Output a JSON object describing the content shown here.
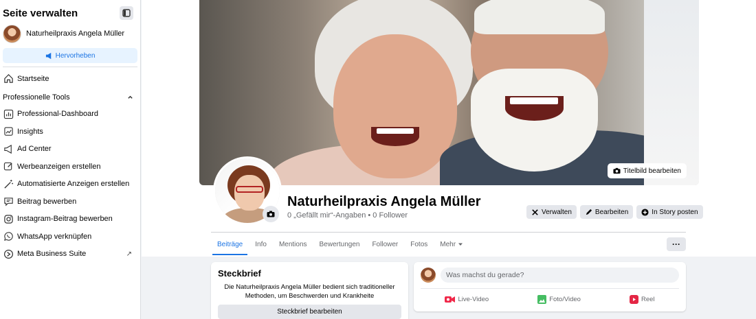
{
  "sidebar": {
    "title": "Seite verwalten",
    "page_name": "Naturheilpraxis Angela Müller",
    "promote_label": "Hervorheben",
    "home_label": "Startseite",
    "section_label": "Professionelle Tools",
    "items": [
      {
        "label": "Professional-Dashboard",
        "icon": "dashboard-icon"
      },
      {
        "label": "Insights",
        "icon": "insights-icon"
      },
      {
        "label": "Ad Center",
        "icon": "megaphone-icon"
      },
      {
        "label": "Werbeanzeigen erstellen",
        "icon": "pencil-icon"
      },
      {
        "label": "Automatisierte Anzeigen erstellen",
        "icon": "magic-wand-icon"
      },
      {
        "label": "Beitrag bewerben",
        "icon": "speech-bubble-icon"
      },
      {
        "label": "Instagram-Beitrag bewerben",
        "icon": "instagram-icon"
      },
      {
        "label": "WhatsApp verknüpfen",
        "icon": "whatsapp-icon"
      },
      {
        "label": "Meta Business Suite",
        "icon": "meta-business-icon"
      }
    ]
  },
  "cover": {
    "edit_label": "Titelbild bearbeiten"
  },
  "profile": {
    "name": "Naturheilpraxis Angela Müller",
    "stats": "0 „Gefällt mir“-Angaben • 0 Follower",
    "actions": [
      "Verwalten",
      "Bearbeiten",
      "In Story posten"
    ]
  },
  "tabs": [
    "Beiträge",
    "Info",
    "Mentions",
    "Bewertungen",
    "Follower",
    "Fotos",
    "Mehr"
  ],
  "intro": {
    "title": "Steckbrief",
    "text": "Die Naturheilpraxis Angela Müller bedient sich traditioneller Methoden, um Beschwerden und Krankheite",
    "button": "Steckbrief bearbeiten"
  },
  "composer": {
    "placeholder": "Was machst du gerade?",
    "actions": [
      "Live-Video",
      "Foto/Video",
      "Reel"
    ]
  },
  "colors": {
    "accent": "#1b74e4",
    "background": "#f0f2f5",
    "live": "#f02849",
    "photo": "#45bd62",
    "reel": "#e42645"
  }
}
